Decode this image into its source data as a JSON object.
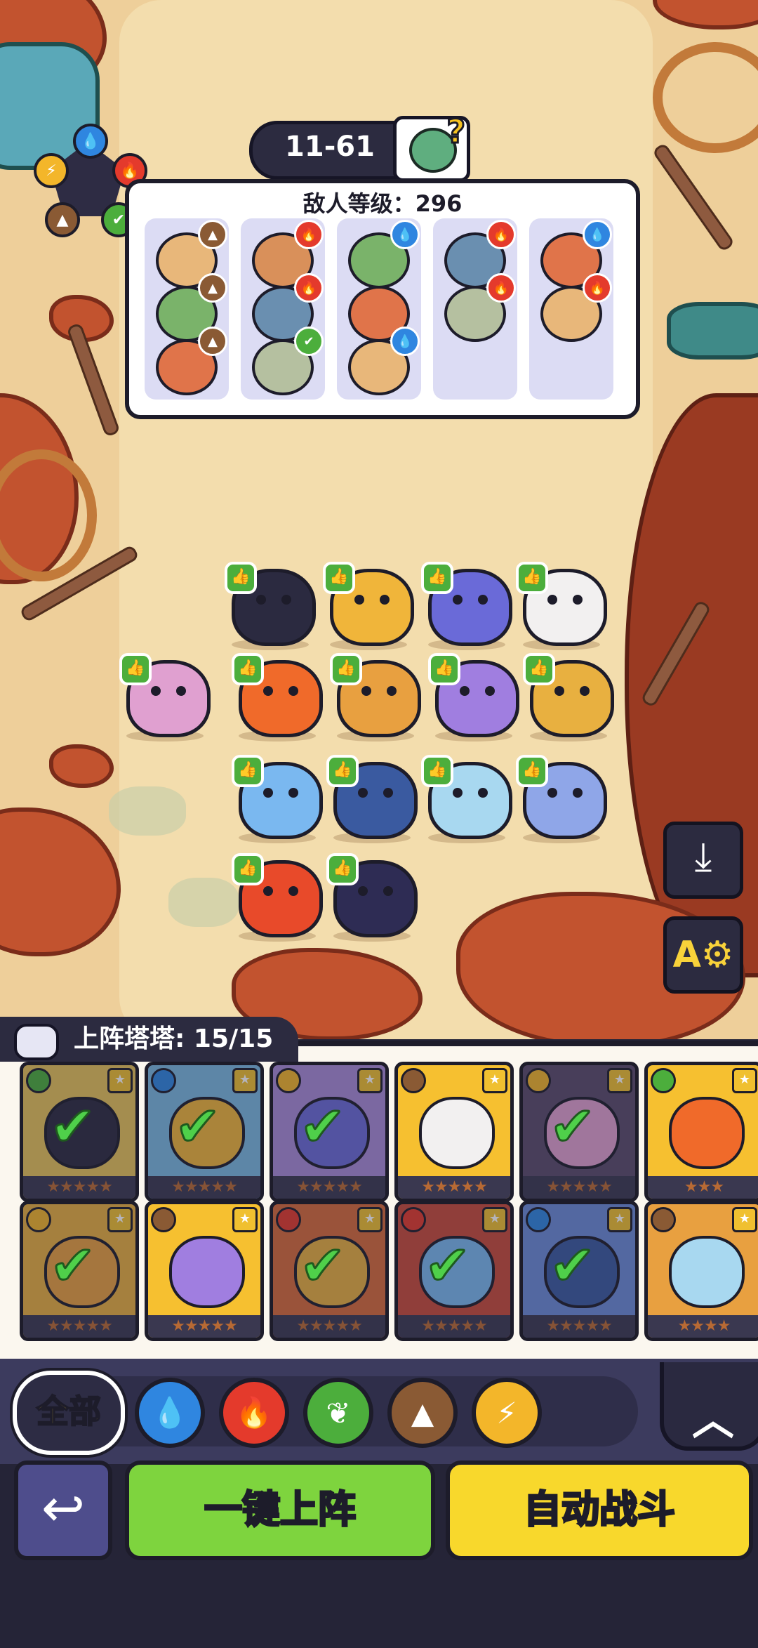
{
  "level": {
    "stage": "11-61"
  },
  "enemy_panel": {
    "title": "敌人等级：296",
    "columns": [
      [
        "earth",
        "earth",
        "earth"
      ],
      [
        "fire",
        "fire",
        "leaf"
      ],
      [
        "water",
        "",
        "water"
      ],
      [
        "fire",
        "fire"
      ],
      [
        "water",
        "fire"
      ]
    ]
  },
  "roster": {
    "counter_label": "上阵塔塔: 15/15",
    "cards": [
      {
        "element": "leaf",
        "stars": "★★★★★",
        "selected": true
      },
      {
        "element": "water",
        "stars": "★★★★★",
        "selected": true
      },
      {
        "element": "lightning",
        "stars": "★★★★★",
        "selected": true
      },
      {
        "element": "earth",
        "stars": "★★★★★",
        "selected": false
      },
      {
        "element": "lightning",
        "stars": "★★★★★",
        "selected": true
      },
      {
        "element": "leaf",
        "stars": "★★★",
        "selected": false
      },
      {
        "element": "lightning",
        "stars": "★★★★★",
        "selected": true
      },
      {
        "element": "earth",
        "stars": "★★★★★",
        "selected": false
      },
      {
        "element": "fire",
        "stars": "★★★★★",
        "selected": true
      },
      {
        "element": "fire",
        "stars": "★★★★★",
        "selected": true
      },
      {
        "element": "water",
        "stars": "★★★★★",
        "selected": true
      },
      {
        "element": "earth",
        "stars": "★★★★",
        "selected": false
      }
    ]
  },
  "filters": {
    "all_label": "全部",
    "items": [
      "water-icon",
      "fire-icon",
      "leaf-icon",
      "earth-icon",
      "lightning-icon"
    ]
  },
  "actions": {
    "deploy_label": "一键上阵",
    "auto_label": "自动战斗"
  },
  "colors": {
    "water": "#2f86e0",
    "fire": "#e43a2c",
    "leaf": "#4cae3c",
    "earth": "#8a5a34",
    "lightning": "#f3b62a"
  }
}
